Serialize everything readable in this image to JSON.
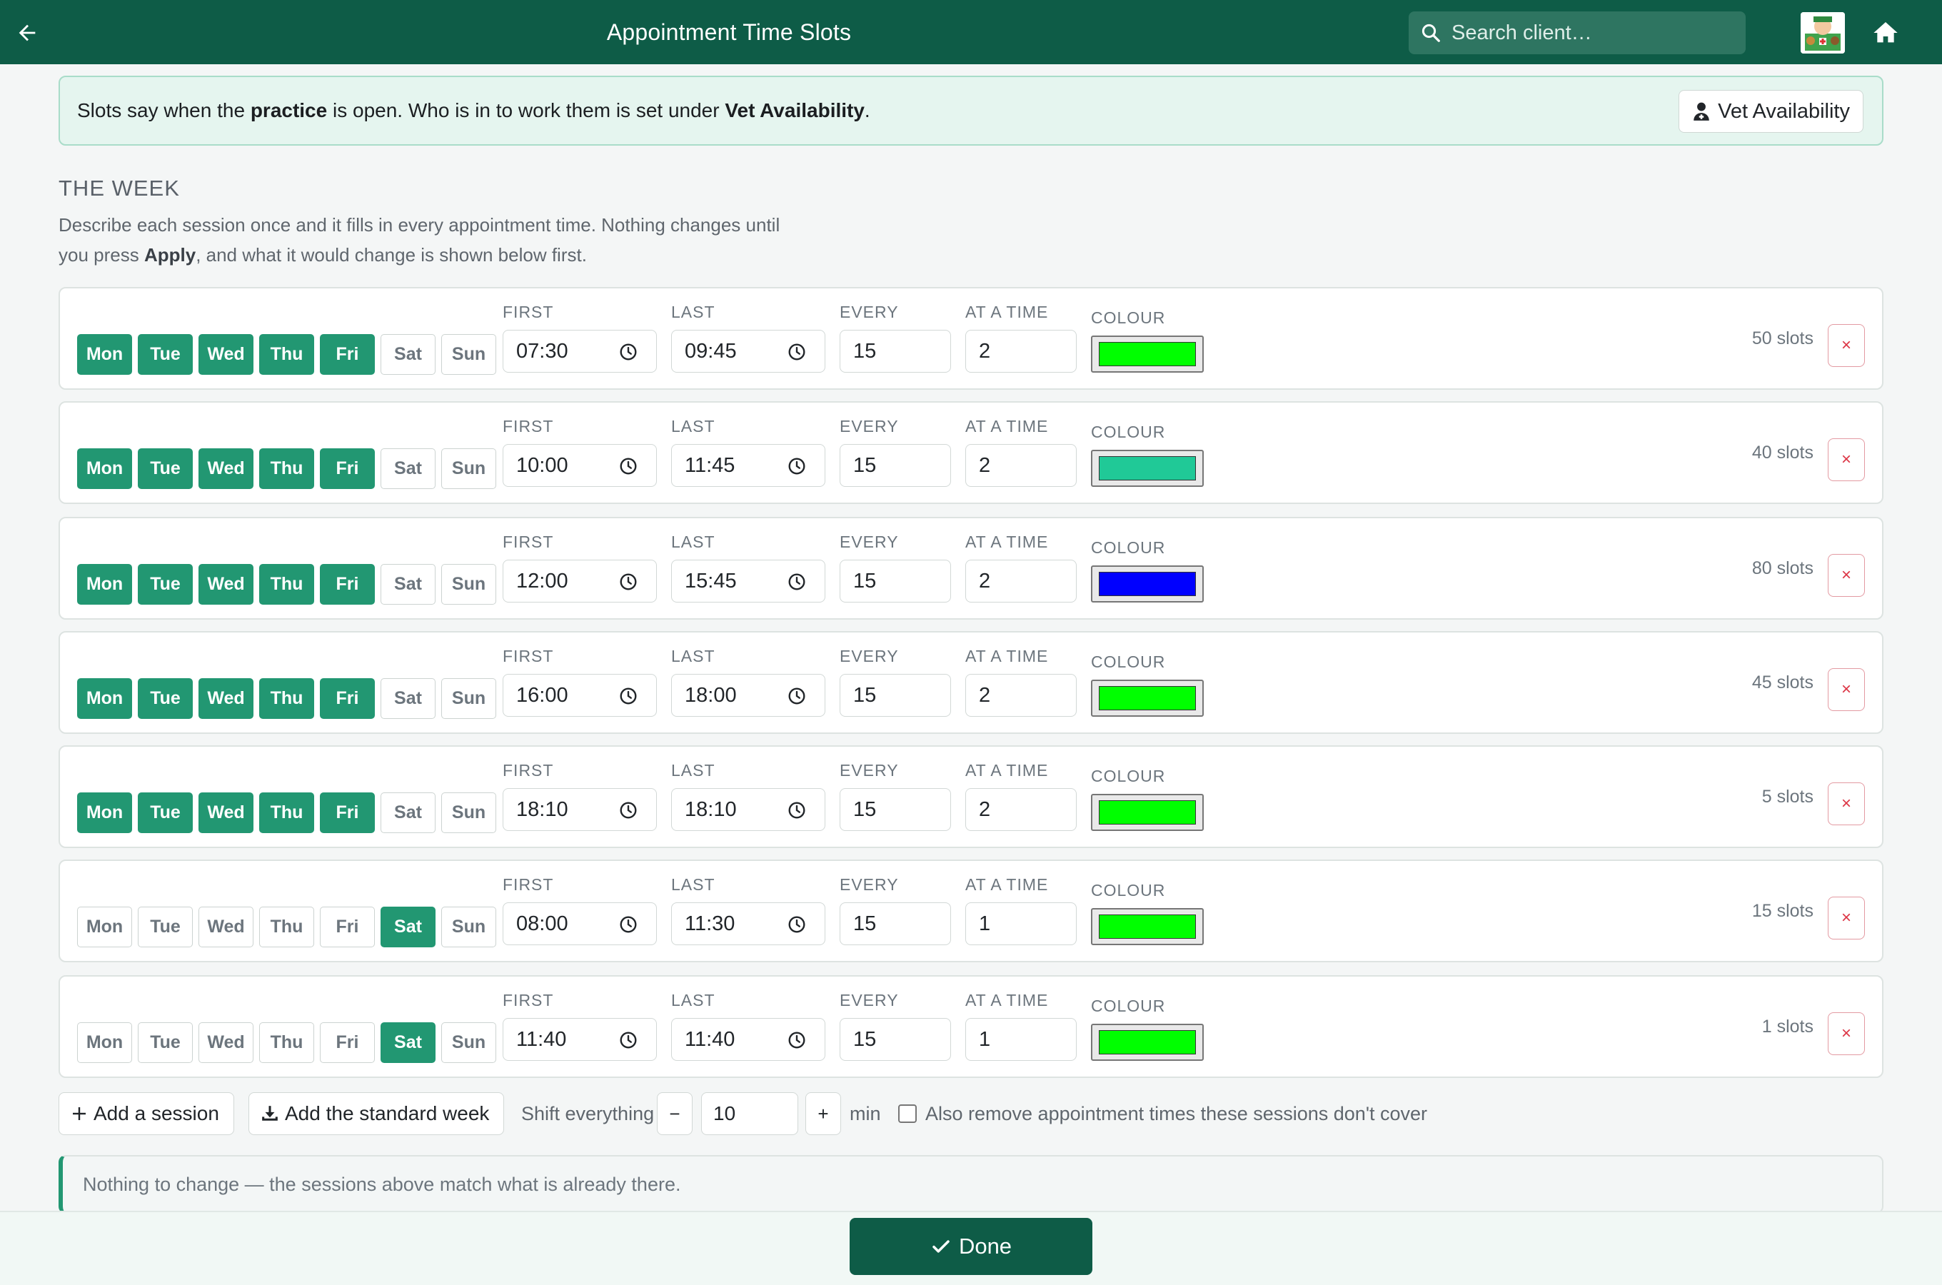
{
  "header": {
    "title": "Appointment Time Slots",
    "search_placeholder": "Search client…",
    "back_icon": "arrow-left-icon",
    "home_icon": "home-icon",
    "bg_color": "#0e5c47"
  },
  "banner": {
    "text_1": "Slots say when the ",
    "bold_1": "practice",
    "text_2": " is open. Who is in to work them is set under ",
    "bold_2": "Vet Availability",
    "text_3": ".",
    "button_label": "Vet Availability"
  },
  "week": {
    "title": "THE WEEK",
    "desc_1": "Describe each session once and it fills in every appointment time. Nothing changes until",
    "desc_2": "you press ",
    "desc_bold": "Apply",
    "desc_3": ", and what it would change is shown below first."
  },
  "labels": {
    "first": "FIRST",
    "last": "LAST",
    "every": "EVERY",
    "at_a_time": "AT A TIME",
    "colour": "COLOUR",
    "delete": "×"
  },
  "day_names": [
    "Mon",
    "Tue",
    "Wed",
    "Thu",
    "Fri",
    "Sat",
    "Sun"
  ],
  "sessions": [
    {
      "days_on": [
        true,
        true,
        true,
        true,
        true,
        false,
        false
      ],
      "first": "07:30",
      "last": "09:45",
      "every": "15",
      "at_a_time": "2",
      "colour": "#00ff00",
      "slots": "50 slots"
    },
    {
      "days_on": [
        true,
        true,
        true,
        true,
        true,
        false,
        false
      ],
      "first": "10:00",
      "last": "11:45",
      "every": "15",
      "at_a_time": "2",
      "colour": "#20c997",
      "slots": "40 slots"
    },
    {
      "days_on": [
        true,
        true,
        true,
        true,
        true,
        false,
        false
      ],
      "first": "12:00",
      "last": "15:45",
      "every": "15",
      "at_a_time": "2",
      "colour": "#0000ff",
      "slots": "80 slots"
    },
    {
      "days_on": [
        true,
        true,
        true,
        true,
        true,
        false,
        false
      ],
      "first": "16:00",
      "last": "18:00",
      "every": "15",
      "at_a_time": "2",
      "colour": "#00ff00",
      "slots": "45 slots"
    },
    {
      "days_on": [
        true,
        true,
        true,
        true,
        true,
        false,
        false
      ],
      "first": "18:10",
      "last": "18:10",
      "every": "15",
      "at_a_time": "2",
      "colour": "#00ff00",
      "slots": "5 slots"
    },
    {
      "days_on": [
        false,
        false,
        false,
        false,
        false,
        true,
        false
      ],
      "first": "08:00",
      "last": "11:30",
      "every": "15",
      "at_a_time": "1",
      "colour": "#00ff00",
      "slots": "15 slots"
    },
    {
      "days_on": [
        false,
        false,
        false,
        false,
        false,
        true,
        false
      ],
      "first": "11:40",
      "last": "11:40",
      "every": "15",
      "at_a_time": "1",
      "colour": "#00ff00",
      "slots": "1 slots"
    }
  ],
  "controls": {
    "add_session": "Add a session",
    "add_standard_week": "Add the standard week",
    "shift_label": "Shift everything",
    "minus": "−",
    "plus": "+",
    "shift_value": "10",
    "min_label": "min",
    "remove_label": "Also remove appointment times these sessions don't cover"
  },
  "notice": {
    "text": "Nothing to change — the sessions above match what is already there."
  },
  "footer": {
    "done_label": "Done"
  }
}
